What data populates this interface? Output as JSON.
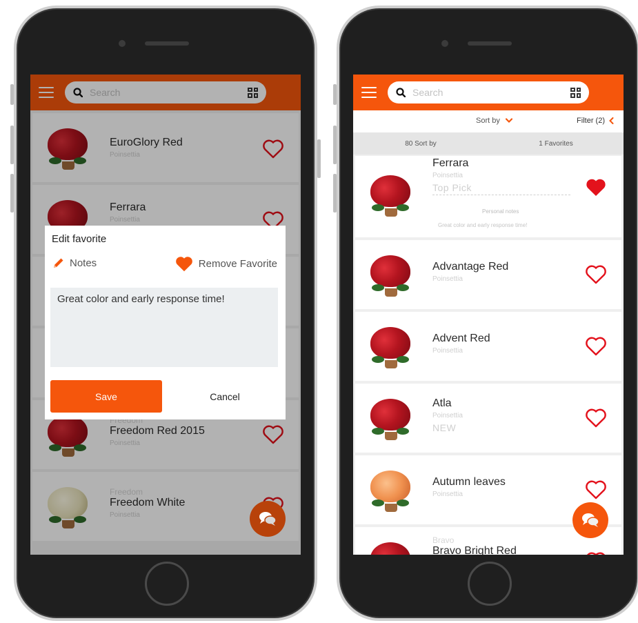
{
  "colors": {
    "brand": "#f5560c",
    "brand_dim": "#b34510",
    "heart": "#e3121c"
  },
  "left_phone": {
    "search": {
      "placeholder": "Search"
    },
    "rows": [
      {
        "series": "",
        "name": "EuroGlory Red",
        "species": "Poinsettia",
        "favorite": false,
        "bloom": "red"
      },
      {
        "series": "",
        "name": "Ferrara",
        "species": "Poinsettia",
        "favorite": false,
        "bloom": "red"
      },
      {
        "series": "Freedom",
        "name": "Freedom Red 2015",
        "species": "Poinsettia",
        "favorite": false,
        "bloom": "red"
      },
      {
        "series": "Freedom",
        "name": "Freedom White",
        "species": "Poinsettia",
        "favorite": false,
        "bloom": "white"
      }
    ],
    "modal": {
      "title": "Edit favorite",
      "notes_label": "Notes",
      "remove_label": "Remove Favorite",
      "note_text": "Great color and early response time!",
      "save_label": "Save",
      "cancel_label": "Cancel"
    }
  },
  "right_phone": {
    "search": {
      "placeholder": "Search"
    },
    "toolbar": {
      "sort_label": "Sort by",
      "filter_label": "Filter (2)"
    },
    "stats": {
      "count_label": "80 Sort by",
      "favorites_label": "1 Favorites"
    },
    "rows": [
      {
        "series": "",
        "name": "Ferrara",
        "species": "Poinsettia",
        "tag": "Top Pick",
        "favorite": true,
        "bloom": "red",
        "personal_notes_label": "Personal notes",
        "personal_notes": "Great color and early response time!"
      },
      {
        "series": "",
        "name": "Advantage Red",
        "species": "Poinsettia",
        "tag": "",
        "favorite": false,
        "bloom": "red"
      },
      {
        "series": "",
        "name": "Advent Red",
        "species": "Poinsettia",
        "tag": "",
        "favorite": false,
        "bloom": "red"
      },
      {
        "series": "",
        "name": "Atla",
        "species": "Poinsettia",
        "tag": "NEW",
        "favorite": false,
        "bloom": "red"
      },
      {
        "series": "",
        "name": "Autumn leaves",
        "species": "Poinsettia",
        "tag": "",
        "favorite": false,
        "bloom": "orange"
      },
      {
        "series": "Bravo",
        "name": "Bravo Bright Red",
        "species": "",
        "tag": "",
        "favorite": false,
        "bloom": "red"
      }
    ]
  }
}
